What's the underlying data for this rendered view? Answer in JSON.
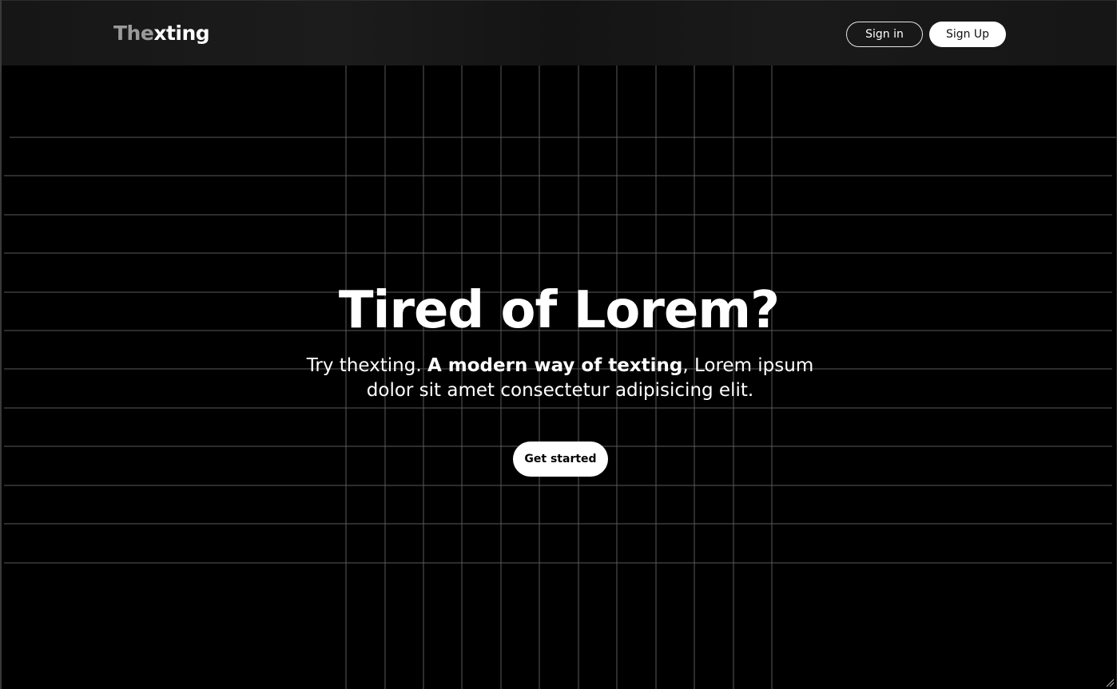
{
  "header": {
    "logo_pre": "The",
    "logo_post": "xting",
    "signin_label": "Sign in",
    "signup_label": "Sign Up"
  },
  "hero": {
    "title": "Tired of Lorem?",
    "subtitle_lead": "Try thexting. ",
    "subtitle_bold": "A modern way of texting",
    "subtitle_rest": ", Lorem ipsum dolor sit amet consectetur adipisicing elit.",
    "cta_label": "Get started"
  },
  "colors": {
    "background": "#000000",
    "header_bg": "#181818",
    "logo_muted": "#9a9a9a",
    "grid_line": "#5a5a5a",
    "button_light": "#ffffff"
  },
  "icons": {
    "resize_grip": "resize-grip-icon"
  }
}
